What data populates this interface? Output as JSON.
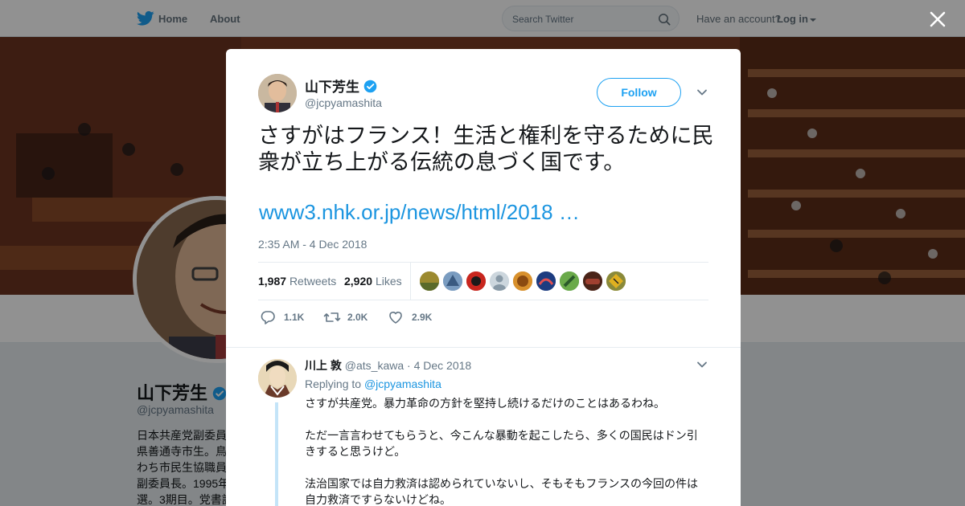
{
  "nav": {
    "home": "Home",
    "about": "About",
    "search_placeholder": "Search Twitter",
    "have_account": "Have an account?",
    "login": "Log in"
  },
  "profile": {
    "name": "山下芳生",
    "handle": "@jcpyamashita",
    "bio_lines": [
      "日本共産党副委員",
      "県善通寺市生。鳥",
      "わち市民生協職員",
      "副委員長。1995年",
      "選。3期目。党書記"
    ]
  },
  "tweet": {
    "author_name": "山下芳生",
    "author_handle": "@jcpyamashita",
    "follow_label": "Follow",
    "text": "さすがはフランス！生活と権利を守るために民衆が立ち上がる伝統の息づく国です。",
    "link": "www3.nhk.or.jp/news/html/2018 …",
    "timestamp": "2:35 AM - 4 Dec 2018",
    "retweets_count": "1,987",
    "retweets_label": "Retweets",
    "likes_count": "2,920",
    "likes_label": "Likes",
    "actions": {
      "reply_count": "1.1K",
      "retweet_count": "2.0K",
      "like_count": "2.9K"
    }
  },
  "reply": {
    "author_name": "川上 敦",
    "author_handle": "@ats_kawa",
    "date": "· 4 Dec 2018",
    "replying_to_label": "Replying to",
    "replying_to_mention": "@jcpyamashita",
    "paragraphs": [
      "さすが共産党。暴力革命の方針を堅持し続けるだけのことはあるわね。",
      "ただ一言言わせてもらうと、今こんな暴動を起こしたら、多くの国民はドン引きすると思うけど。",
      "法治国家では自力救済は認められていないし、そもそもフランスの今回の件は自力救済ですらないけどね。"
    ]
  },
  "colors": {
    "twitter_blue": "#1da1f2",
    "link_blue": "#1b95e0",
    "text_primary": "#14171a",
    "text_secondary": "#657786"
  }
}
